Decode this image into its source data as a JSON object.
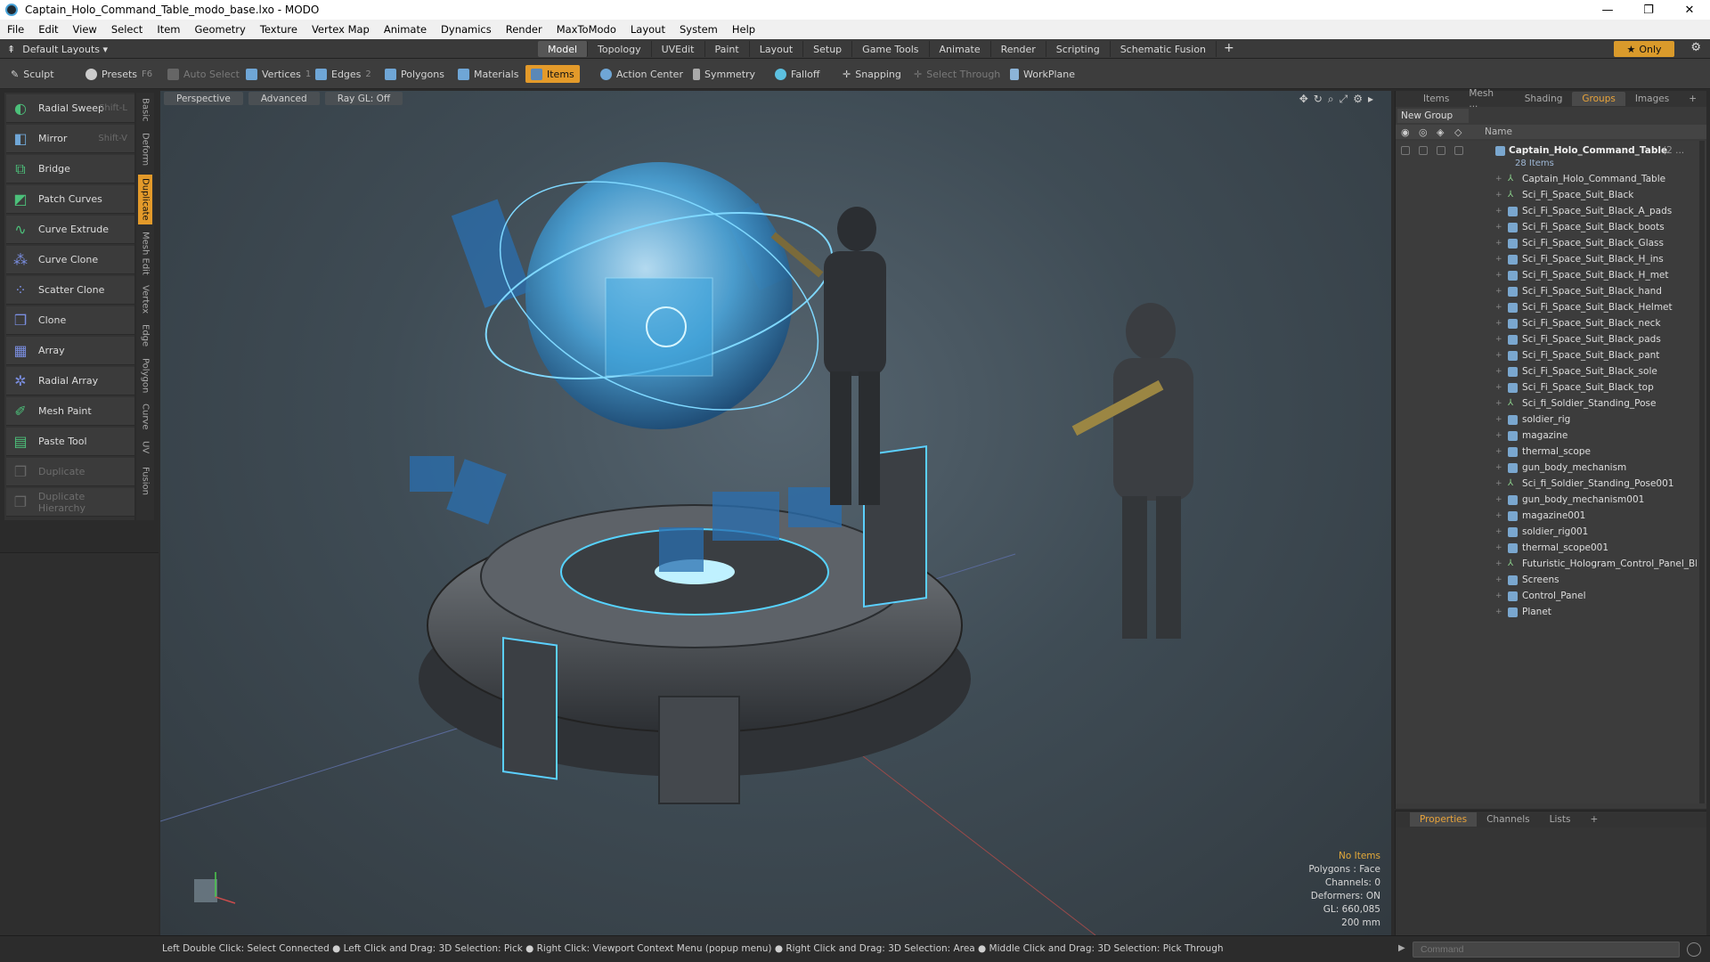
{
  "window": {
    "title": "Captain_Holo_Command_Table_modo_base.lxo - MODO",
    "controls": [
      "—",
      "❐",
      "✕"
    ]
  },
  "menu": [
    "File",
    "Edit",
    "View",
    "Select",
    "Item",
    "Geometry",
    "Texture",
    "Vertex Map",
    "Animate",
    "Dynamics",
    "Render",
    "MaxToModo",
    "Layout",
    "System",
    "Help"
  ],
  "layoutbar": {
    "layout_name": "Default Layouts ▾",
    "tabs": [
      "Model",
      "Topology",
      "UVEdit",
      "Paint",
      "Layout",
      "Setup",
      "Game Tools",
      "Animate",
      "Render",
      "Scripting",
      "Schematic Fusion"
    ],
    "active_tab": "Model",
    "only_label": "Only"
  },
  "toolbar": {
    "sculpt": "Sculpt",
    "presets": "Presets",
    "presets_key": "F6",
    "auto_select": "Auto Select",
    "vertices": "Vertices",
    "vertices_num": "1",
    "edges": "Edges",
    "edges_num": "2",
    "polygons": "Polygons",
    "materials": "Materials",
    "items": "Items",
    "action_center": "Action Center",
    "symmetry": "Symmetry",
    "falloff": "Falloff",
    "snapping": "Snapping",
    "select_through": "Select Through",
    "workplane": "WorkPlane"
  },
  "tools": [
    {
      "label": "Radial Sweep",
      "shortcut": "Shift-L",
      "enabled": true
    },
    {
      "label": "Mirror",
      "shortcut": "Shift-V",
      "enabled": true
    },
    {
      "label": "Bridge",
      "shortcut": "",
      "enabled": true
    },
    {
      "label": "Patch Curves",
      "shortcut": "",
      "enabled": true
    },
    {
      "label": "Curve Extrude",
      "shortcut": "",
      "enabled": true
    },
    {
      "label": "Curve Clone",
      "shortcut": "",
      "enabled": true
    },
    {
      "label": "Scatter Clone",
      "shortcut": "",
      "enabled": true
    },
    {
      "label": "Clone",
      "shortcut": "",
      "enabled": true
    },
    {
      "label": "Array",
      "shortcut": "",
      "enabled": true
    },
    {
      "label": "Radial Array",
      "shortcut": "",
      "enabled": true
    },
    {
      "label": "Mesh Paint",
      "shortcut": "",
      "enabled": true
    },
    {
      "label": "Paste Tool",
      "shortcut": "",
      "enabled": true
    },
    {
      "label": "Duplicate",
      "shortcut": "",
      "enabled": false
    },
    {
      "label": "Duplicate Hierarchy",
      "shortcut": "",
      "enabled": false
    }
  ],
  "side_tabs": [
    "Basic",
    "Deform",
    "Duplicate",
    "Mesh Edit",
    "Vertex",
    "Edge",
    "Polygon",
    "Curve",
    "UV",
    "Fusion"
  ],
  "active_side_tab": "Duplicate",
  "viewport": {
    "tabs": [
      "Perspective",
      "Advanced",
      "Ray GL: Off"
    ],
    "stats": {
      "no_items": "No Items",
      "polygons": "Polygons : Face",
      "channels": "Channels: 0",
      "deformers": "Deformers: ON",
      "gl": "GL: 660,085",
      "scale": "200 mm"
    }
  },
  "panel": {
    "tabs": [
      "Items",
      "Mesh ...",
      "Shading",
      "Groups",
      "Images"
    ],
    "active_tab": "Groups",
    "new_group": "New Group",
    "column_name": "Name",
    "group_name": "Captain_Holo_Command_Table",
    "group_count": "(2 ...",
    "item_count": "28 Items",
    "items": [
      {
        "name": "Captain_Holo_Command_Table",
        "type": "locator"
      },
      {
        "name": "Sci_Fi_Space_Suit_Black",
        "type": "locator"
      },
      {
        "name": "Sci_Fi_Space_Suit_Black_A_pads",
        "type": "mesh"
      },
      {
        "name": "Sci_Fi_Space_Suit_Black_boots",
        "type": "mesh"
      },
      {
        "name": "Sci_Fi_Space_Suit_Black_Glass",
        "type": "mesh"
      },
      {
        "name": "Sci_Fi_Space_Suit_Black_H_ins",
        "type": "mesh"
      },
      {
        "name": "Sci_Fi_Space_Suit_Black_H_met",
        "type": "mesh"
      },
      {
        "name": "Sci_Fi_Space_Suit_Black_hand",
        "type": "mesh"
      },
      {
        "name": "Sci_Fi_Space_Suit_Black_Helmet",
        "type": "mesh"
      },
      {
        "name": "Sci_Fi_Space_Suit_Black_neck",
        "type": "mesh"
      },
      {
        "name": "Sci_Fi_Space_Suit_Black_pads",
        "type": "mesh"
      },
      {
        "name": "Sci_Fi_Space_Suit_Black_pant",
        "type": "mesh"
      },
      {
        "name": "Sci_Fi_Space_Suit_Black_sole",
        "type": "mesh"
      },
      {
        "name": "Sci_Fi_Space_Suit_Black_top",
        "type": "mesh"
      },
      {
        "name": "Sci_fi_Soldier_Standing_Pose",
        "type": "locator"
      },
      {
        "name": "soldier_rig",
        "type": "mesh"
      },
      {
        "name": "magazine",
        "type": "mesh"
      },
      {
        "name": "thermal_scope",
        "type": "mesh"
      },
      {
        "name": "gun_body_mechanism",
        "type": "mesh"
      },
      {
        "name": "Sci_fi_Soldier_Standing_Pose001",
        "type": "locator"
      },
      {
        "name": "gun_body_mechanism001",
        "type": "mesh"
      },
      {
        "name": "magazine001",
        "type": "mesh"
      },
      {
        "name": "soldier_rig001",
        "type": "mesh"
      },
      {
        "name": "thermal_scope001",
        "type": "mesh"
      },
      {
        "name": "Futuristic_Hologram_Control_Panel_Bl...",
        "type": "locator"
      },
      {
        "name": "Screens",
        "type": "mesh"
      },
      {
        "name": "Control_Panel",
        "type": "mesh"
      },
      {
        "name": "Planet",
        "type": "mesh"
      }
    ]
  },
  "props": {
    "tabs": [
      "Properties",
      "Channels",
      "Lists"
    ],
    "active_tab": "Properties"
  },
  "status": {
    "text": "Left Double Click: Select Connected ● Left Click and Drag: 3D Selection: Pick ● Right Click: Viewport Context Menu (popup menu) ● Right Click and Drag: 3D Selection: Area ● Middle Click and Drag: 3D Selection: Pick Through",
    "command_placeholder": "Command"
  },
  "colors": {
    "accent": "#e39a2a",
    "hologram": "#4fc3ff",
    "viewport_bg": "#3f4c55"
  },
  "icons": [
    "sculpt-icon",
    "presets-icon",
    "vertices-icon",
    "edges-icon",
    "polygons-icon",
    "materials-icon",
    "items-icon",
    "action-center-icon",
    "symmetry-icon",
    "falloff-icon",
    "snapping-icon",
    "workplane-icon",
    "eye-icon",
    "lock-icon",
    "gear-icon",
    "star-icon",
    "plus-icon"
  ]
}
